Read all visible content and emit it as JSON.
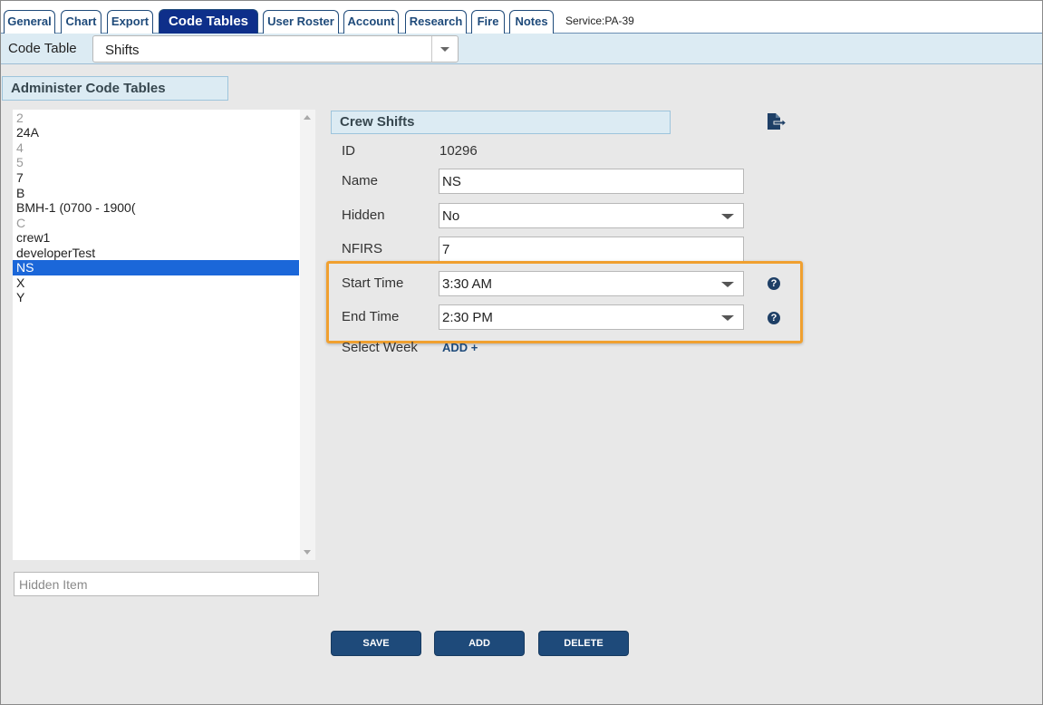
{
  "tabs": [
    "General",
    "Chart",
    "Export",
    "Code Tables",
    "User Roster",
    "Account",
    "Research",
    "Fire",
    "Notes"
  ],
  "active_tab": "Code Tables",
  "service_label": "Service:PA-39",
  "code_table": {
    "label": "Code Table",
    "selected": "Shifts"
  },
  "left_panel": {
    "title": "Administer Code Tables",
    "items": [
      {
        "label": "2",
        "hidden": true
      },
      {
        "label": "24A",
        "hidden": false
      },
      {
        "label": "4",
        "hidden": true
      },
      {
        "label": "5",
        "hidden": true
      },
      {
        "label": "7",
        "hidden": false
      },
      {
        "label": "B",
        "hidden": false
      },
      {
        "label": "BMH-1 (0700 - 1900(",
        "hidden": false
      },
      {
        "label": "C",
        "hidden": true
      },
      {
        "label": "crew1",
        "hidden": false
      },
      {
        "label": "developerTest",
        "hidden": false
      },
      {
        "label": "NS",
        "hidden": false,
        "selected": true
      },
      {
        "label": "X",
        "hidden": false
      },
      {
        "label": "Y",
        "hidden": false
      }
    ],
    "hidden_item_placeholder": "Hidden Item"
  },
  "form": {
    "title": "Crew Shifts",
    "id_label": "ID",
    "id_value": "10296",
    "name_label": "Name",
    "name_value": "NS",
    "hidden_label": "Hidden",
    "hidden_value": "No",
    "nfirs_label": "NFIRS",
    "nfirs_value": "7",
    "start_time_label": "Start Time",
    "start_time_value": "3:30 AM",
    "end_time_label": "End Time",
    "end_time_value": "2:30 PM",
    "select_week_label": "Select Week",
    "add_link": "ADD +",
    "help_glyph": "?"
  },
  "buttons": {
    "save": "SAVE",
    "add": "ADD",
    "delete": "DELETE"
  },
  "colors": {
    "tab_active_bg": "#0e2f8a",
    "accent": "#1e4a7a",
    "highlight": "#f0a030",
    "selection": "#1b67d9",
    "header_bg": "#dcebf3"
  }
}
